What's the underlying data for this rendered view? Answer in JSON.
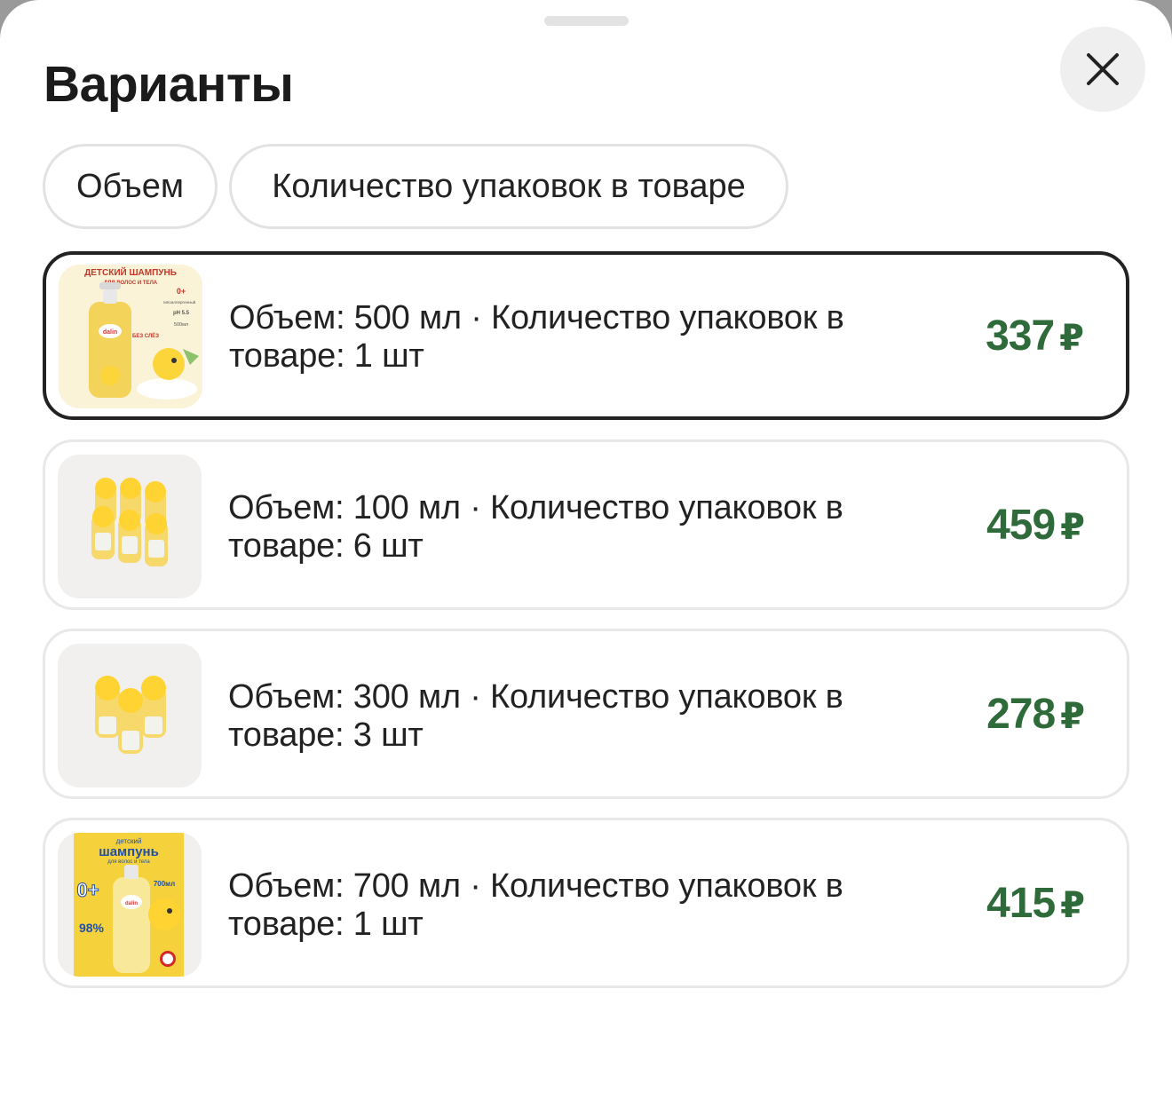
{
  "sheet": {
    "title": "Варианты",
    "close_icon": "close-icon"
  },
  "filters": {
    "volume_label": "Объем",
    "quantity_label": "Количество упаковок в товаре"
  },
  "variants": [
    {
      "text": "Объем: 500 мл · Количество упаковок в товаре: 1 шт",
      "price": "337",
      "currency": "₽",
      "selected": true,
      "image": "product-500ml-image",
      "image_text": {
        "line1": "ДЕТСКИЙ ШАМПУНЬ",
        "line2": "ДЛЯ ВОЛОС И ТЕЛА",
        "age": "0+",
        "hypo": "гипоаллергенный",
        "ph": "pH 5.5",
        "volume": "500мл",
        "tearless": "БЕЗ СЛЁЗ",
        "brand": "dalin"
      }
    },
    {
      "text": "Объем: 100 мл · Количество упаковок в товаре: 6 шт",
      "price": "459",
      "currency": "₽",
      "selected": false,
      "image": "product-100ml-x6-image"
    },
    {
      "text": "Объем: 300 мл · Количество упаковок в товаре: 3 шт",
      "price": "278",
      "currency": "₽",
      "selected": false,
      "image": "product-300ml-x3-image"
    },
    {
      "text": "Объем: 700 мл · Количество упаковок в товаре: 1 шт",
      "price": "415",
      "currency": "₽",
      "selected": false,
      "image": "product-700ml-image",
      "image_text": {
        "line1": "детский",
        "line2": "шампунь",
        "line3": "для волос и тела",
        "age": "0+",
        "volume": "700мл",
        "percent": "98%",
        "brand": "dalin"
      }
    }
  ],
  "colors": {
    "price": "#2f6b3a",
    "selected_border": "#222222",
    "card_border": "#e8e8e8",
    "thumb_bg": "#f1f0ef"
  }
}
